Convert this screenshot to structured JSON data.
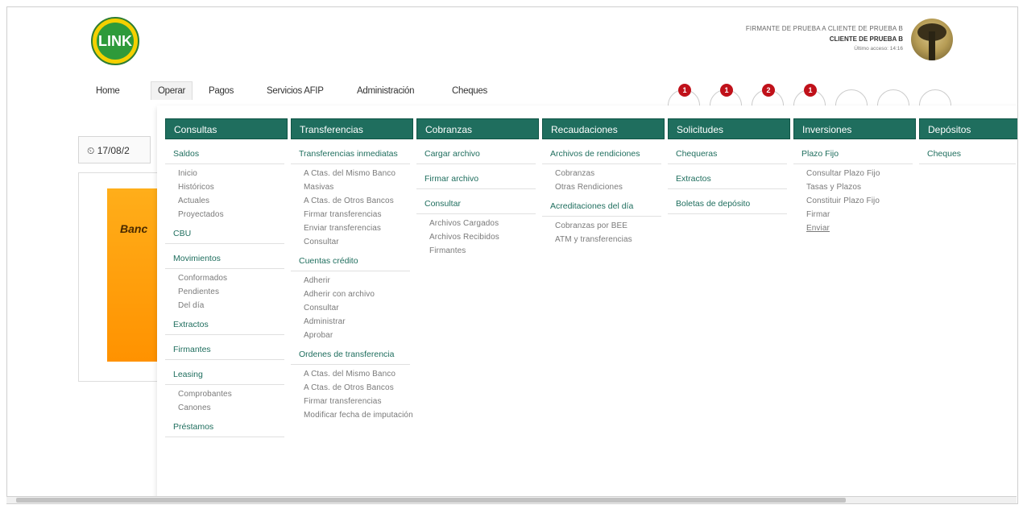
{
  "header": {
    "logo_text": "LINK",
    "user_line1": "FIRMANTE DE PRUEBA A CLIENTE DE PRUEBA B",
    "user_line2": "CLIENTE DE PRUEBA B",
    "user_line3": "Último acceso: 14:16"
  },
  "nav": {
    "items": [
      "Home",
      "Operar",
      "Pagos",
      "Servicios AFIP",
      "Administración",
      "Cheques"
    ]
  },
  "icons": [
    {
      "name": "calendar-icon",
      "badge": "1"
    },
    {
      "name": "mail-icon",
      "badge": "1"
    },
    {
      "name": "chat-icon",
      "badge": "2"
    },
    {
      "name": "alert-icon",
      "badge": "1"
    },
    {
      "name": "user-icon",
      "badge": ""
    },
    {
      "name": "help-icon",
      "badge": ""
    },
    {
      "name": "logout-icon",
      "badge": ""
    }
  ],
  "date_value": "17/08/2",
  "banner_text": "Banc",
  "menu": {
    "consultas": {
      "title": "Consultas",
      "saldos": "Saldos",
      "saldos_items": [
        "Inicio",
        "Históricos",
        "Actuales",
        "Proyectados"
      ],
      "cbu": "CBU",
      "movimientos": "Movimientos",
      "movimientos_items": [
        "Conformados",
        "Pendientes",
        "Del día"
      ],
      "extractos": "Extractos",
      "firmantes": "Firmantes",
      "leasing": "Leasing",
      "leasing_items": [
        "Comprobantes",
        "Canones"
      ],
      "prestamos": "Préstamos"
    },
    "transferencias": {
      "title": "Transferencias",
      "inmediatas": "Transferencias inmediatas",
      "inmediatas_items": [
        "A Ctas. del Mismo Banco",
        "Masivas",
        "A Ctas. de Otros Bancos",
        "Firmar transferencias",
        "Enviar transferencias",
        "Consultar"
      ],
      "cuentas_credito": "Cuentas crédito",
      "cuentas_items": [
        "Adherir",
        "Adherir con archivo",
        "Consultar",
        "Administrar",
        "Aprobar"
      ],
      "ordenes": "Ordenes de transferencia",
      "ordenes_items": [
        "A Ctas. del Mismo Banco",
        "A Ctas. de Otros Bancos",
        "Firmar transferencias",
        "Modificar fecha de imputación"
      ]
    },
    "cobranzas": {
      "title": "Cobranzas",
      "cargar": "Cargar archivo",
      "firmar": "Firmar archivo",
      "consultar": "Consultar",
      "consultar_items": [
        "Archivos Cargados",
        "Archivos Recibidos",
        "Firmantes"
      ]
    },
    "recaudaciones": {
      "title": "Recaudaciones",
      "archivos": "Archivos de rendiciones",
      "archivos_items": [
        "Cobranzas",
        "Otras Rendiciones"
      ],
      "acreditaciones": "Acreditaciones del día",
      "acreditaciones_items": [
        "Cobranzas por BEE",
        "ATM y transferencias"
      ]
    },
    "solicitudes": {
      "title": "Solicitudes",
      "chequeras": "Chequeras",
      "extractos": "Extractos",
      "boletas": "Boletas de depósito"
    },
    "inversiones": {
      "title": "Inversiones",
      "plazo": "Plazo Fijo",
      "plazo_items": [
        "Consultar Plazo Fijo",
        "Tasas y Plazos",
        "Constituir Plazo Fijo",
        "Firmar",
        "Enviar"
      ]
    },
    "depositos": {
      "title": "Depósitos",
      "cheques": "Cheques"
    }
  }
}
